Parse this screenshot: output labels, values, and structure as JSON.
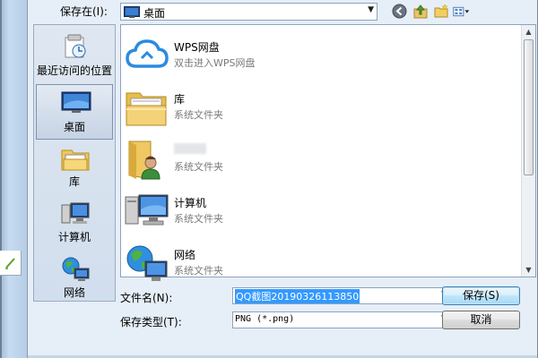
{
  "header": {
    "save_in_label": "保存在(I):",
    "location": "桌面"
  },
  "places": [
    {
      "label": "最近访问的位置",
      "icon": "recent-places-icon"
    },
    {
      "label": "桌面",
      "icon": "desktop-icon",
      "selected": true
    },
    {
      "label": "库",
      "icon": "library-icon"
    },
    {
      "label": "计算机",
      "icon": "computer-icon"
    },
    {
      "label": "网络",
      "icon": "network-icon"
    }
  ],
  "files": [
    {
      "name": "WPS网盘",
      "type": "双击进入WPS网盘",
      "icon": "wps-cloud-icon"
    },
    {
      "name": "库",
      "type": "系统文件夹",
      "icon": "library-folder-icon"
    },
    {
      "name": "",
      "type": "系统文件夹",
      "icon": "user-folder-icon"
    },
    {
      "name": "计算机",
      "type": "系统文件夹",
      "icon": "computer-icon"
    },
    {
      "name": "网络",
      "type": "系统文件夹",
      "icon": "network-icon"
    }
  ],
  "form": {
    "filename_label": "文件名(N):",
    "filename_value": "QQ截图20190326113850",
    "filetype_label": "保存类型(T):",
    "filetype_value": "PNG (*.png)",
    "save_button": "保存(S)",
    "cancel_button": "取消"
  },
  "colors": {
    "selection": "#3399ff",
    "dialog_bg": "#e6eef8",
    "accent": "#2f7ae5"
  }
}
